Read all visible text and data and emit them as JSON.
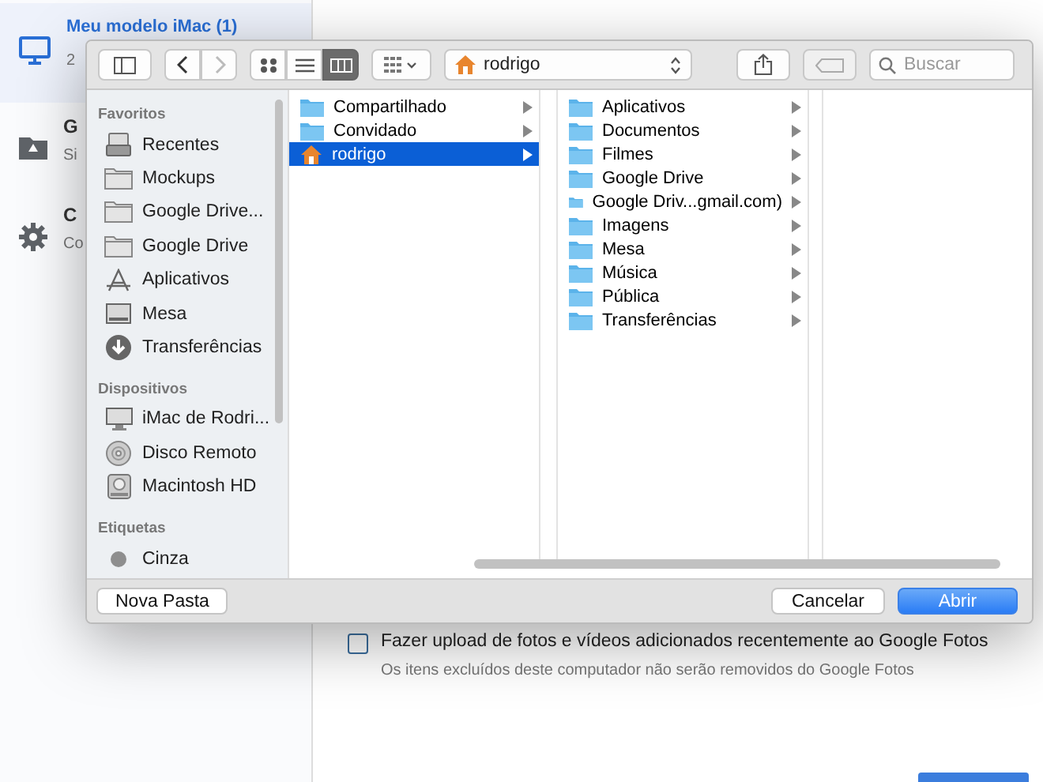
{
  "app": {
    "sidebar": [
      {
        "title": "Meu modelo iMac (1)",
        "subtitle": "2",
        "kind": "monitor",
        "selected": true
      },
      {
        "title": "G",
        "subtitle": "Si",
        "kind": "drive",
        "selected": false
      },
      {
        "title": "C",
        "subtitle": "Co",
        "kind": "gear",
        "selected": false
      }
    ],
    "option": {
      "label": "Fazer upload de fotos e vídeos adicionados recentemente ao Google Fotos",
      "checked": false,
      "hint": "Os itens excluídos deste computador não serão removidos do Google Fotos"
    }
  },
  "dialog": {
    "toolbar": {
      "nav": [
        {
          "disabled": false
        },
        {
          "disabled": true
        }
      ],
      "views": [
        {
          "kind": "icons",
          "selected": false
        },
        {
          "kind": "list",
          "selected": false
        },
        {
          "kind": "columns",
          "selected": true
        }
      ],
      "path": "rodrigo",
      "search": {
        "placeholder": "Buscar"
      }
    },
    "sidebar": [
      {
        "heading": "Favoritos",
        "items": [
          {
            "label": "Recentes",
            "kind": "recents"
          },
          {
            "label": "Mockups",
            "kind": "folder"
          },
          {
            "label": "Google Drive...",
            "kind": "folder"
          },
          {
            "label": "Google Drive",
            "kind": "folder"
          },
          {
            "label": "Aplicativos",
            "kind": "apps"
          },
          {
            "label": "Mesa",
            "kind": "desktop"
          },
          {
            "label": "Transferências",
            "kind": "download"
          }
        ]
      },
      {
        "heading": "Dispositivos",
        "items": [
          {
            "label": "iMac de Rodri...",
            "kind": "imac"
          },
          {
            "label": "Disco Remoto",
            "kind": "disc"
          },
          {
            "label": "Macintosh HD",
            "kind": "hd"
          }
        ]
      },
      {
        "heading": "Etiquetas",
        "items": [
          {
            "label": "Cinza",
            "kind": "tag",
            "color": "#8e8e8e"
          }
        ]
      }
    ],
    "columns": [
      [
        {
          "name": "Compartilhado",
          "kind": "folder",
          "selected": false
        },
        {
          "name": "Convidado",
          "kind": "folder",
          "selected": false
        },
        {
          "name": "rodrigo",
          "kind": "home",
          "selected": true
        }
      ],
      [
        {
          "name": "Aplicativos",
          "kind": "folder",
          "selected": false
        },
        {
          "name": "Documentos",
          "kind": "folder",
          "selected": false
        },
        {
          "name": "Filmes",
          "kind": "folder",
          "selected": false
        },
        {
          "name": "Google Drive",
          "kind": "folder",
          "selected": false
        },
        {
          "name": "Google Driv...gmail.com)",
          "kind": "folder",
          "selected": false
        },
        {
          "name": "Imagens",
          "kind": "folder",
          "selected": false
        },
        {
          "name": "Mesa",
          "kind": "folder",
          "selected": false
        },
        {
          "name": "Música",
          "kind": "folder",
          "selected": false
        },
        {
          "name": "Pública",
          "kind": "folder",
          "selected": false
        },
        {
          "name": "Transferências",
          "kind": "folder",
          "selected": false
        }
      ]
    ],
    "buttons": {
      "new_folder": "Nova Pasta",
      "cancel": "Cancelar",
      "open": "Abrir"
    }
  }
}
